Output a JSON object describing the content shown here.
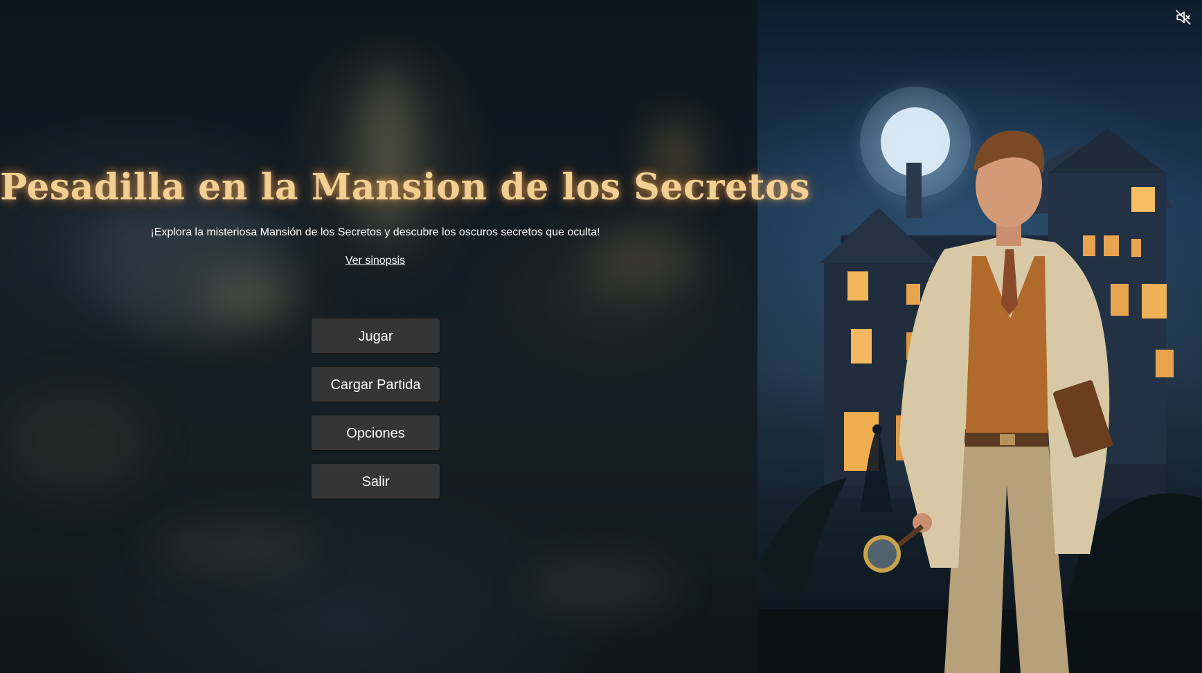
{
  "game": {
    "title": "Pesadilla en la Mansion de los Secretos",
    "tagline": "¡Explora la misteriosa Mansión de los Secretos y descubre los oscuros secretos que oculta!",
    "synopsis_link": "Ver sinopsis"
  },
  "menu": {
    "items": [
      {
        "label": "Jugar"
      },
      {
        "label": "Cargar Partida"
      },
      {
        "label": "Opciones"
      },
      {
        "label": "Salir"
      }
    ]
  },
  "audio": {
    "icon": "speaker-muted-icon",
    "muted": true
  },
  "colors": {
    "title": "#f2cf93",
    "title_glow": "#e8a050",
    "button_bg": "#353535",
    "text": "#ffffff"
  }
}
